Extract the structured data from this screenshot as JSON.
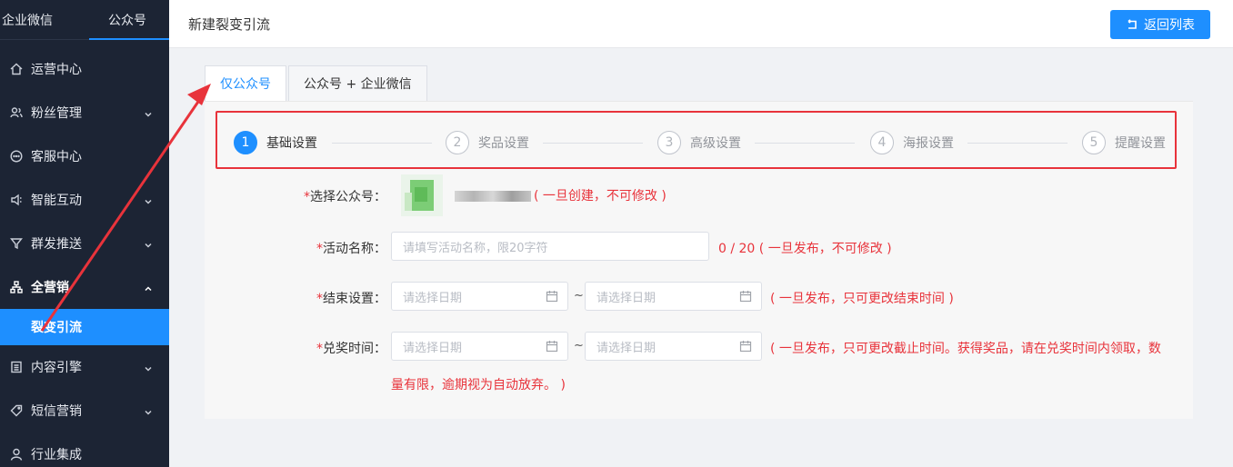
{
  "sidebar": {
    "tabs": [
      "企业微信",
      "公众号"
    ],
    "items": [
      {
        "label": "运营中心",
        "icon": "home-icon",
        "chevron": false
      },
      {
        "label": "粉丝管理",
        "icon": "users-icon",
        "chevron": true
      },
      {
        "label": "客服中心",
        "icon": "chat-icon",
        "chevron": false
      },
      {
        "label": "智能互动",
        "icon": "speaker-icon",
        "chevron": true
      },
      {
        "label": "群发推送",
        "icon": "funnel-icon",
        "chevron": true
      },
      {
        "label": "全营销",
        "icon": "sitemap-icon",
        "chevron": "up"
      },
      {
        "label": "内容引擎",
        "icon": "doc-icon",
        "chevron": true
      },
      {
        "label": "短信营销",
        "icon": "tag-icon",
        "chevron": true
      },
      {
        "label": "行业集成",
        "icon": "user-icon",
        "chevron": false
      }
    ],
    "submenu": {
      "label": "裂变引流"
    }
  },
  "header": {
    "title": "新建裂变引流",
    "back_label": "返回列表"
  },
  "tabs": [
    "仅公众号",
    "公众号 + 企业微信"
  ],
  "steps": [
    {
      "num": "1",
      "label": "基础设置"
    },
    {
      "num": "2",
      "label": "奖品设置"
    },
    {
      "num": "3",
      "label": "高级设置"
    },
    {
      "num": "4",
      "label": "海报设置"
    },
    {
      "num": "5",
      "label": "提醒设置"
    }
  ],
  "form": {
    "account": {
      "label": "选择公众号：",
      "hint": "( 一旦创建，不可修改 )"
    },
    "name": {
      "label": "活动名称：",
      "placeholder": "请填写活动名称，限20字符",
      "count": "0 / 20",
      "hint": "( 一旦发布，不可修改 )"
    },
    "end": {
      "label": "结束设置：",
      "start_placeholder": "请选择日期",
      "end_placeholder": "请选择日期",
      "separator": "~",
      "hint": "( 一旦发布，只可更改结束时间 )"
    },
    "redeem": {
      "label": "兑奖时间：",
      "start_placeholder": "请选择日期",
      "end_placeholder": "请选择日期",
      "separator": "~",
      "hint_line1": "( 一旦发布，只可更改截止时间。获得奖品，请在兑奖时间内领取，数",
      "hint_line2": "量有限，逾期视为自动放弃。 )"
    }
  },
  "colors": {
    "primary": "#1e8fff",
    "sidebar_bg": "#1c2434",
    "warning_red": "#e8333b"
  }
}
